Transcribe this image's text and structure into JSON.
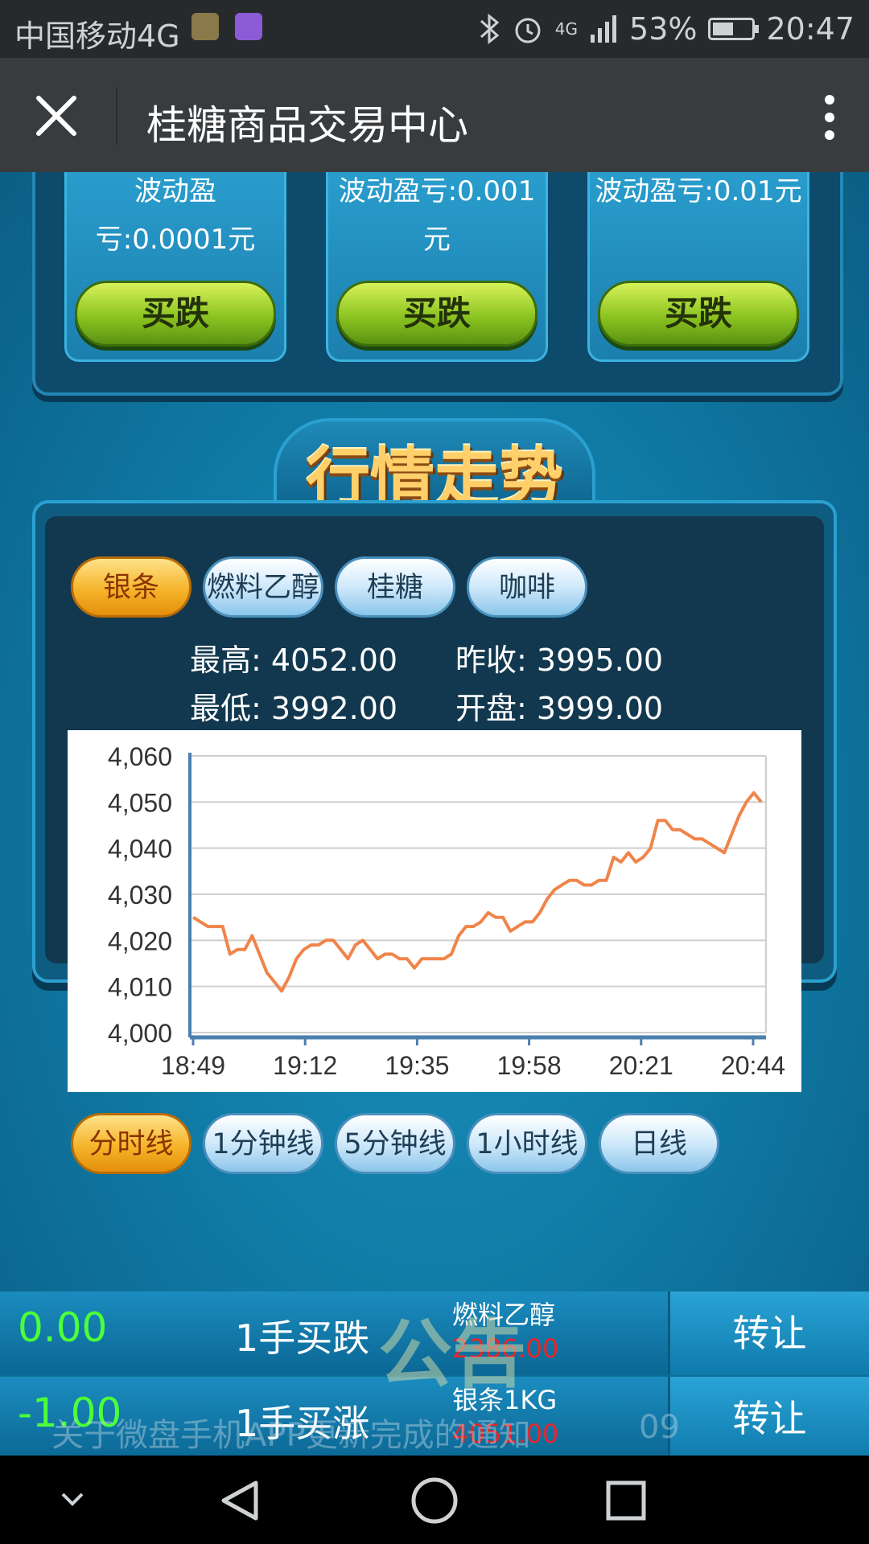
{
  "status_bar": {
    "carrier": "中国移动4G",
    "network": "4G",
    "battery": "53%",
    "battery_level": 0.53,
    "time": "20:47"
  },
  "title_bar": {
    "title": "桂糖商品交易中心"
  },
  "products": [
    {
      "desc": "波动盈亏:0.0001元",
      "button": "买跌"
    },
    {
      "desc": "波动盈亏:0.001元",
      "button": "买跌"
    },
    {
      "desc": "波动盈亏:0.01元",
      "button": "买跌"
    }
  ],
  "market": {
    "header": "行情走势",
    "commodity_tabs": [
      "银条",
      "燃料乙醇",
      "桂糖",
      "咖啡"
    ],
    "active_commodity": 0,
    "stats": {
      "high_label": "最高:",
      "high": "4052.00",
      "prev_label": "昨收:",
      "prev": "3995.00",
      "low_label": "最低:",
      "low": "3992.00",
      "open_label": "开盘:",
      "open": "3999.00"
    },
    "interval_tabs": [
      "分时线",
      "1分钟线",
      "5分钟线",
      "1小时线",
      "日线"
    ],
    "active_interval": 0
  },
  "chart_data": {
    "type": "line",
    "y_ticks": [
      "4,000",
      "4,010",
      "4,020",
      "4,030",
      "4,040",
      "4,050",
      "4,060"
    ],
    "x_ticks": [
      "18:49",
      "19:12",
      "19:35",
      "19:58",
      "20:21",
      "20:44"
    ],
    "ylim": [
      4000,
      4060
    ],
    "grid": true,
    "color": "#f0844a",
    "series": [
      {
        "values": [
          4025,
          4024,
          4023,
          4023,
          4023,
          4017,
          4018,
          4018,
          4021,
          4017,
          4013,
          4011,
          4009,
          4012,
          4016,
          4018,
          4019,
          4019,
          4020,
          4020,
          4018,
          4016,
          4019,
          4020,
          4018,
          4016,
          4017,
          4017,
          4016,
          4016,
          4014,
          4016,
          4016,
          4016,
          4016,
          4017,
          4021,
          4023,
          4023,
          4024,
          4026,
          4025,
          4025,
          4022,
          4023,
          4024,
          4024,
          4026,
          4029,
          4031,
          4032,
          4033,
          4033,
          4032,
          4032,
          4033,
          4033,
          4038,
          4037,
          4039,
          4037,
          4038,
          4040,
          4046,
          4046,
          4044,
          4044,
          4043,
          4042,
          4042,
          4041,
          4040,
          4039,
          4043,
          4047,
          4050,
          4052,
          4050
        ]
      }
    ]
  },
  "bottom_rows": [
    {
      "value": "0.00",
      "value_color": "#4cff3a",
      "action": "1手买跌",
      "product": "燃料乙醇",
      "price": "2386.00",
      "button": "转让"
    },
    {
      "value": "-1.00",
      "value_color": "#4cff3a",
      "action": "1手买涨",
      "product": "银条1KG",
      "price": "4051.00",
      "button": "转让"
    }
  ],
  "notice": {
    "text": "关于微盘手机APP更新完成的通知",
    "watermark": "公告",
    "suffix": "09"
  }
}
